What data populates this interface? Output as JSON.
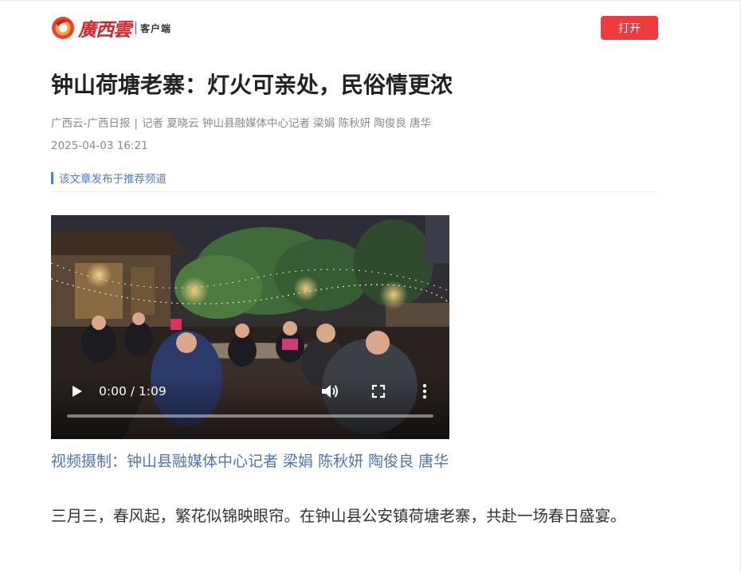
{
  "header": {
    "brand": "廣西雲",
    "brand_sub": "客户端",
    "open_button": "打开"
  },
  "article": {
    "title": "钟山荷塘老寨：灯火可亲处，民俗情更浓",
    "source": "广西云-广西日报",
    "authors": "记者 夏晓云 钟山县融媒体中心记者 梁娟 陈秋妍 陶俊良 唐华",
    "date": "2025-04-03 16:21",
    "channel_notice": "该文章发布于推荐频道",
    "video": {
      "time": "0:00 / 1:09",
      "progress": 0
    },
    "video_caption": "视频摄制：钟山县融媒体中心记者 梁娟 陈秋妍 陶俊良 唐华",
    "paragraph": "三月三，春风起，繁花似锦映眼帘。在钟山县公安镇荷塘老寨，共赴一场春日盛宴。"
  },
  "colors": {
    "accent_red": "#ee3b3f",
    "link_blue": "#4d7bd6",
    "caption_blue": "#4d75b8"
  },
  "icons": [
    "logo-mark-icon",
    "play-icon",
    "volume-icon",
    "fullscreen-icon",
    "more-vertical-icon"
  ]
}
